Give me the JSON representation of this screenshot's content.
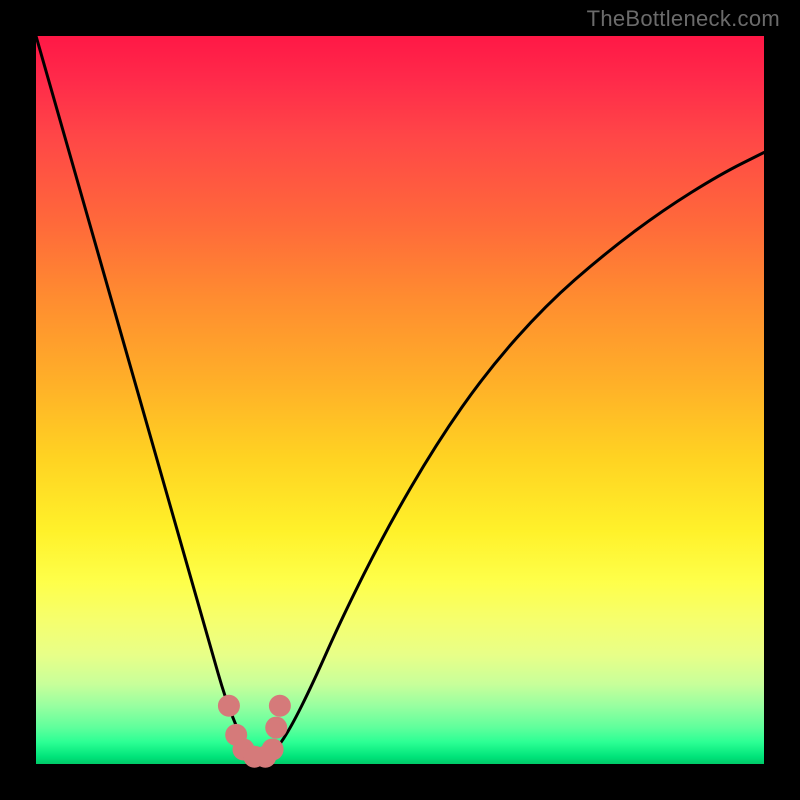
{
  "watermark": "TheBottleneck.com",
  "chart_data": {
    "type": "line",
    "title": "",
    "xlabel": "",
    "ylabel": "",
    "xlim": [
      0,
      100
    ],
    "ylim": [
      0,
      100
    ],
    "series": [
      {
        "name": "bottleneck-curve",
        "x": [
          0,
          4,
          8,
          12,
          16,
          20,
          24,
          26,
          28,
          29,
          30,
          31,
          32,
          33,
          35,
          38,
          42,
          48,
          55,
          62,
          70,
          78,
          86,
          94,
          100
        ],
        "y": [
          100,
          86,
          72,
          58,
          44,
          30,
          16,
          9,
          4,
          2,
          1,
          1,
          1,
          2,
          5,
          11,
          20,
          32,
          44,
          54,
          63,
          70,
          76,
          81,
          84
        ]
      }
    ],
    "marker_points": {
      "name": "highlight-bumps",
      "color": "#d57a7a",
      "points": [
        {
          "x": 26.5,
          "y": 8
        },
        {
          "x": 27.5,
          "y": 4
        },
        {
          "x": 28.5,
          "y": 2
        },
        {
          "x": 30.0,
          "y": 1
        },
        {
          "x": 31.5,
          "y": 1
        },
        {
          "x": 32.5,
          "y": 2
        },
        {
          "x": 33.0,
          "y": 5
        },
        {
          "x": 33.5,
          "y": 8
        }
      ]
    },
    "gradient_stops": [
      {
        "pos": 0,
        "color": "#ff1846"
      },
      {
        "pos": 26,
        "color": "#ff6a3a"
      },
      {
        "pos": 58,
        "color": "#ffd322"
      },
      {
        "pos": 80,
        "color": "#f6ff6c"
      },
      {
        "pos": 95,
        "color": "#5fff9c"
      },
      {
        "pos": 100,
        "color": "#00c968"
      }
    ]
  }
}
